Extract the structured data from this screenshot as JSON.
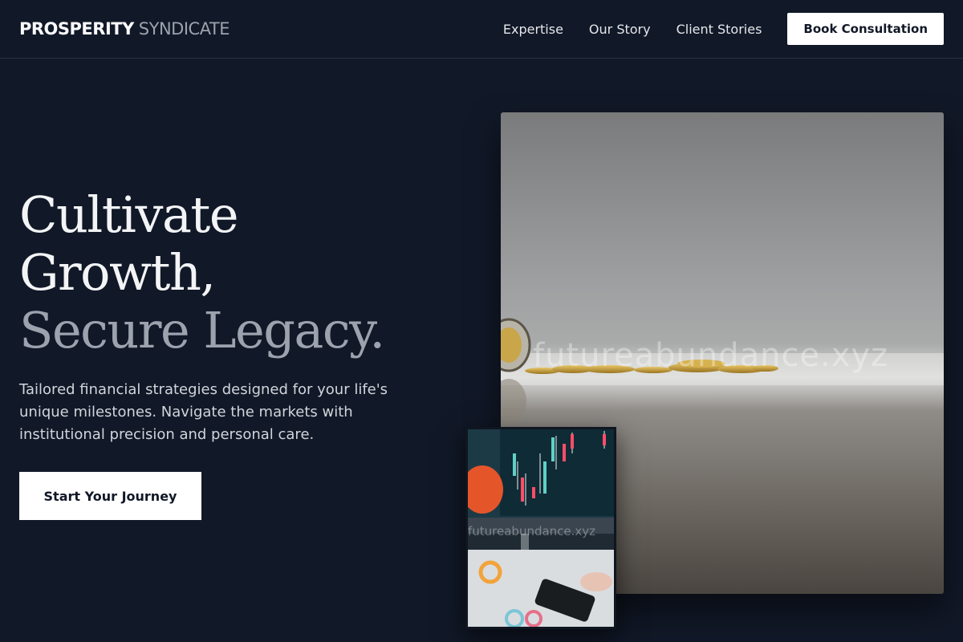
{
  "brand": {
    "strong": "PROSPERITY",
    "light": "SYNDICATE"
  },
  "nav": {
    "links": [
      "Expertise",
      "Our Story",
      "Client Stories"
    ],
    "cta_label": "Book Consultation"
  },
  "hero": {
    "title_line1": "Cultivate",
    "title_line2": "Growth,",
    "title_line3": "Secure Legacy.",
    "description": "Tailored financial strategies designed for your life's unique milestones. Navigate the markets with institutional precision and personal care.",
    "cta_label": "Start Your Journey"
  },
  "images": {
    "main_watermark": "futureabundance.xyz",
    "small_watermark": "futureabundance.xyz"
  },
  "colors": {
    "background": "#111827",
    "accent": "#ffffff",
    "muted_text": "#9ca3af"
  }
}
